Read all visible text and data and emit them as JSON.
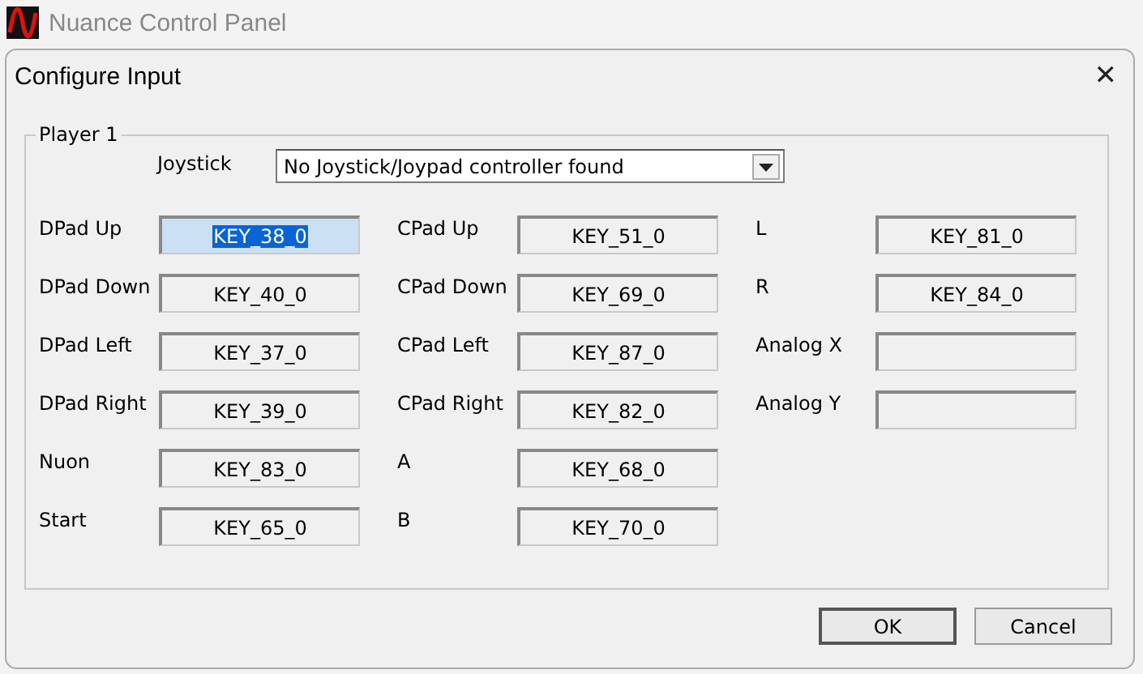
{
  "app_window": {
    "title": "Nuance Control Panel"
  },
  "dialog": {
    "title": "Configure Input",
    "close": "✕"
  },
  "group": {
    "title": "Player 1",
    "joystick_label": "Joystick",
    "joystick_value": "No Joystick/Joypad controller found"
  },
  "binding_columns": [
    [
      {
        "label": "DPad Up",
        "value": "KEY_38_0",
        "selected": true
      },
      {
        "label": "DPad Down",
        "value": "KEY_40_0",
        "selected": false
      },
      {
        "label": "DPad Left",
        "value": "KEY_37_0",
        "selected": false
      },
      {
        "label": "DPad Right",
        "value": "KEY_39_0",
        "selected": false
      },
      {
        "label": "Nuon",
        "value": "KEY_83_0",
        "selected": false
      },
      {
        "label": "Start",
        "value": "KEY_65_0",
        "selected": false
      }
    ],
    [
      {
        "label": "CPad Up",
        "value": "KEY_51_0",
        "selected": false
      },
      {
        "label": "CPad Down",
        "value": "KEY_69_0",
        "selected": false
      },
      {
        "label": "CPad Left",
        "value": "KEY_87_0",
        "selected": false
      },
      {
        "label": "CPad Right",
        "value": "KEY_82_0",
        "selected": false
      },
      {
        "label": "A",
        "value": "KEY_68_0",
        "selected": false
      },
      {
        "label": "B",
        "value": "KEY_70_0",
        "selected": false
      }
    ],
    [
      {
        "label": "L",
        "value": "KEY_81_0",
        "selected": false
      },
      {
        "label": "R",
        "value": "KEY_84_0",
        "selected": false
      },
      {
        "label": "Analog X",
        "selected": false
      },
      {
        "label": "Analog Y",
        "selected": false
      }
    ]
  ],
  "buttons": [
    "OK",
    "Cancel"
  ]
}
